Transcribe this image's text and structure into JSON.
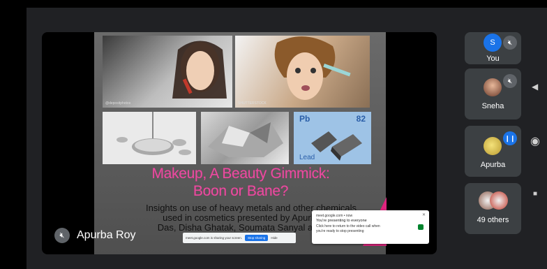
{
  "slide": {
    "title_line1": "Makeup, A Beauty Gimmick:",
    "title_line2": "Boon or Bane?",
    "subtitle_line1": "Insights on use of heavy metals and other chemicals",
    "subtitle_line2": "used in cosmetics presented by Apurba Roy",
    "subtitle_line3": "Das, Disha Ghatak, Soumata Sanyal and Tana",
    "element_symbol": "Pb",
    "element_number": "82",
    "element_name": "Lead",
    "photo1_caption": "@depositphotos",
    "photo2_caption": "SHUTTERSTOCK"
  },
  "presenter": {
    "name": "Apurba Roy"
  },
  "share_bar": {
    "message": "meet.google.com is sharing your screen.",
    "stop_label": "Stop sharing",
    "hide_label": "Hide"
  },
  "notification": {
    "source": "meet.google.com • now",
    "title": "You're presenting to everyone",
    "line1": "Click here to return to the video call when",
    "line2": "you're ready to stop presenting"
  },
  "participants": [
    {
      "name": "You",
      "initial": "S",
      "muted": true
    },
    {
      "name": "Sneha",
      "muted": true
    },
    {
      "name": "Apurba",
      "speaking": true
    },
    {
      "name": "49 others"
    }
  ],
  "colors": {
    "background": "#202124",
    "tile": "#3c4043",
    "accent": "#1a73e8",
    "title_pink": "#e94da0"
  }
}
